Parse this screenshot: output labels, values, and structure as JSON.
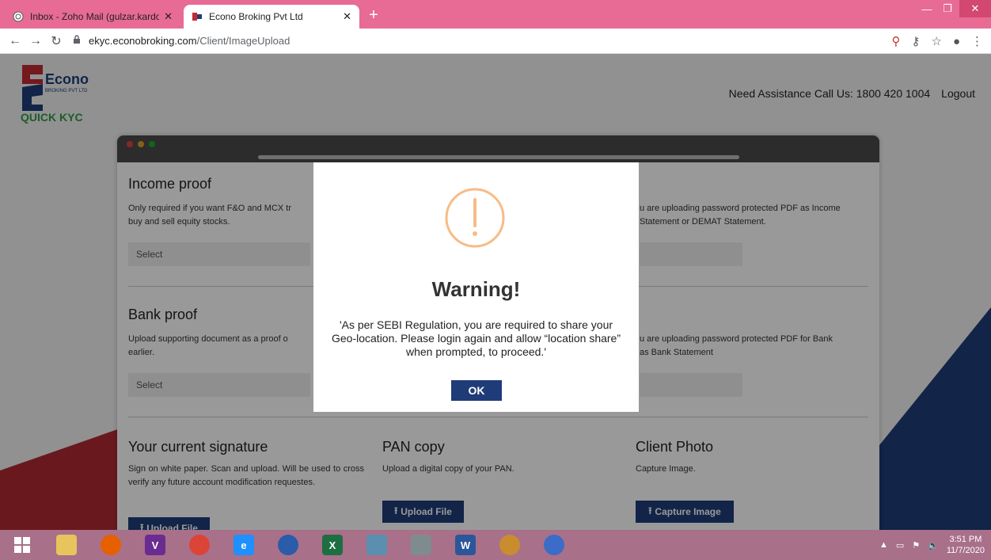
{
  "browser": {
    "tabs": [
      {
        "title": "Inbox - Zoho Mail (gulzar.kardor",
        "active": false
      },
      {
        "title": "Econo Broking Pvt Ltd",
        "active": true
      }
    ],
    "new_tab": "+",
    "url_domain": "ekyc.econobroking.com",
    "url_path": "/Client/ImageUpload"
  },
  "header": {
    "logo_text": "Econo",
    "logo_sub": "BROKING PVT LTD",
    "brand": "QUICK KYC",
    "assist_text": "Need Assistance Call Us: 1800 420 1004",
    "logout": "Logout"
  },
  "sections": {
    "income": {
      "title": "Income proof",
      "desc_left": "Only required if you want F&O and MCX tr",
      "desc_left2": "buy and sell equity stocks.",
      "desc_right": "u are uploading password protected PDF as Income",
      "desc_right2": "Statement or DEMAT Statement.",
      "select": "Select"
    },
    "bank": {
      "title": "Bank proof",
      "desc_left": "Upload supporting document as a proof o",
      "desc_left2": "earlier.",
      "desc_right": "u are uploading password protected PDF for Bank",
      "desc_right2": "as Bank Statement",
      "select": "Select"
    },
    "signature": {
      "title": "Your current signature",
      "desc": "Sign on white paper. Scan and upload. Will be used to cross verify any future account modification requestes.",
      "button": "Upload File"
    },
    "pan": {
      "title": "PAN copy",
      "desc": "Upload a digital copy of your PAN.",
      "button": "Upload File"
    },
    "photo": {
      "title": "Client Photo",
      "desc": "Capture Image.",
      "button": "Capture Image"
    }
  },
  "modal": {
    "title": "Warning!",
    "message": "'As per SEBI Regulation, you are required to share your Geo-location. Please login again and allow “location share” when prompted, to proceed.'",
    "ok": "OK",
    "icon_color": "#f8bb86"
  },
  "taskbar": {
    "time": "3:51 PM",
    "date": "11/7/2020"
  },
  "colors": {
    "brand_blue": "#1f3c78",
    "tab_pink": "#e76b95",
    "taskbar": "#a9708a"
  }
}
